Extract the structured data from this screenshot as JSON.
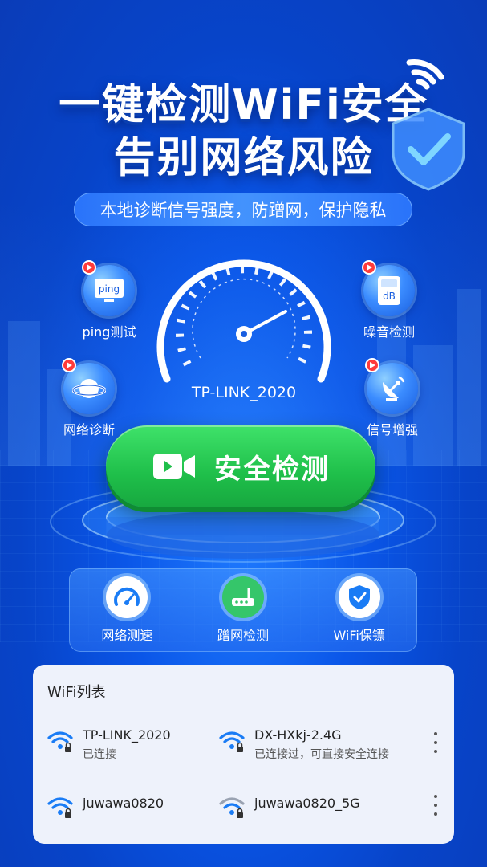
{
  "headline": {
    "line1": "一键检测WiFi安全",
    "line2": "告别网络风险"
  },
  "subtitle": "本地诊断信号强度，防蹭网，保护隐私",
  "features": [
    {
      "label": "ping测试",
      "icon": "ping-monitor-icon",
      "icon_text": "ping"
    },
    {
      "label": "噪音检测",
      "icon": "decibel-meter-icon",
      "icon_text": "dB"
    },
    {
      "label": "网络诊断",
      "icon": "planet-icon"
    },
    {
      "label": "信号增强",
      "icon": "satellite-dish-icon"
    }
  ],
  "gauge": {
    "ssid": "TP-LINK_2020"
  },
  "scan_button": {
    "label": "安全检测",
    "icon": "video-camera-icon"
  },
  "tools": [
    {
      "label": "网络测速",
      "icon": "speedometer-icon"
    },
    {
      "label": "蹭网检测",
      "icon": "router-icon"
    },
    {
      "label": "WiFi保镖",
      "icon": "shield-check-icon"
    }
  ],
  "wifi_list": {
    "title": "WiFi列表",
    "networks": [
      {
        "name": "TP-LINK_2020",
        "status": "已连接",
        "locked": true,
        "signal": "strong"
      },
      {
        "name": "DX-HXkj-2.4G",
        "status": "已连接过，可直接安全连接",
        "locked": true,
        "signal": "strong"
      },
      {
        "name": "juwawa0820",
        "status": "",
        "locked": true,
        "signal": "strong"
      },
      {
        "name": "juwawa0820_5G",
        "status": "",
        "locked": true,
        "signal": "weak"
      }
    ]
  },
  "colors": {
    "primary_blue": "#0a56e8",
    "accent_green": "#1fbf4a",
    "badge_red": "#ff3b3b",
    "wifi_blue": "#1a7cf5",
    "wifi_gray": "#9aa3b2"
  }
}
